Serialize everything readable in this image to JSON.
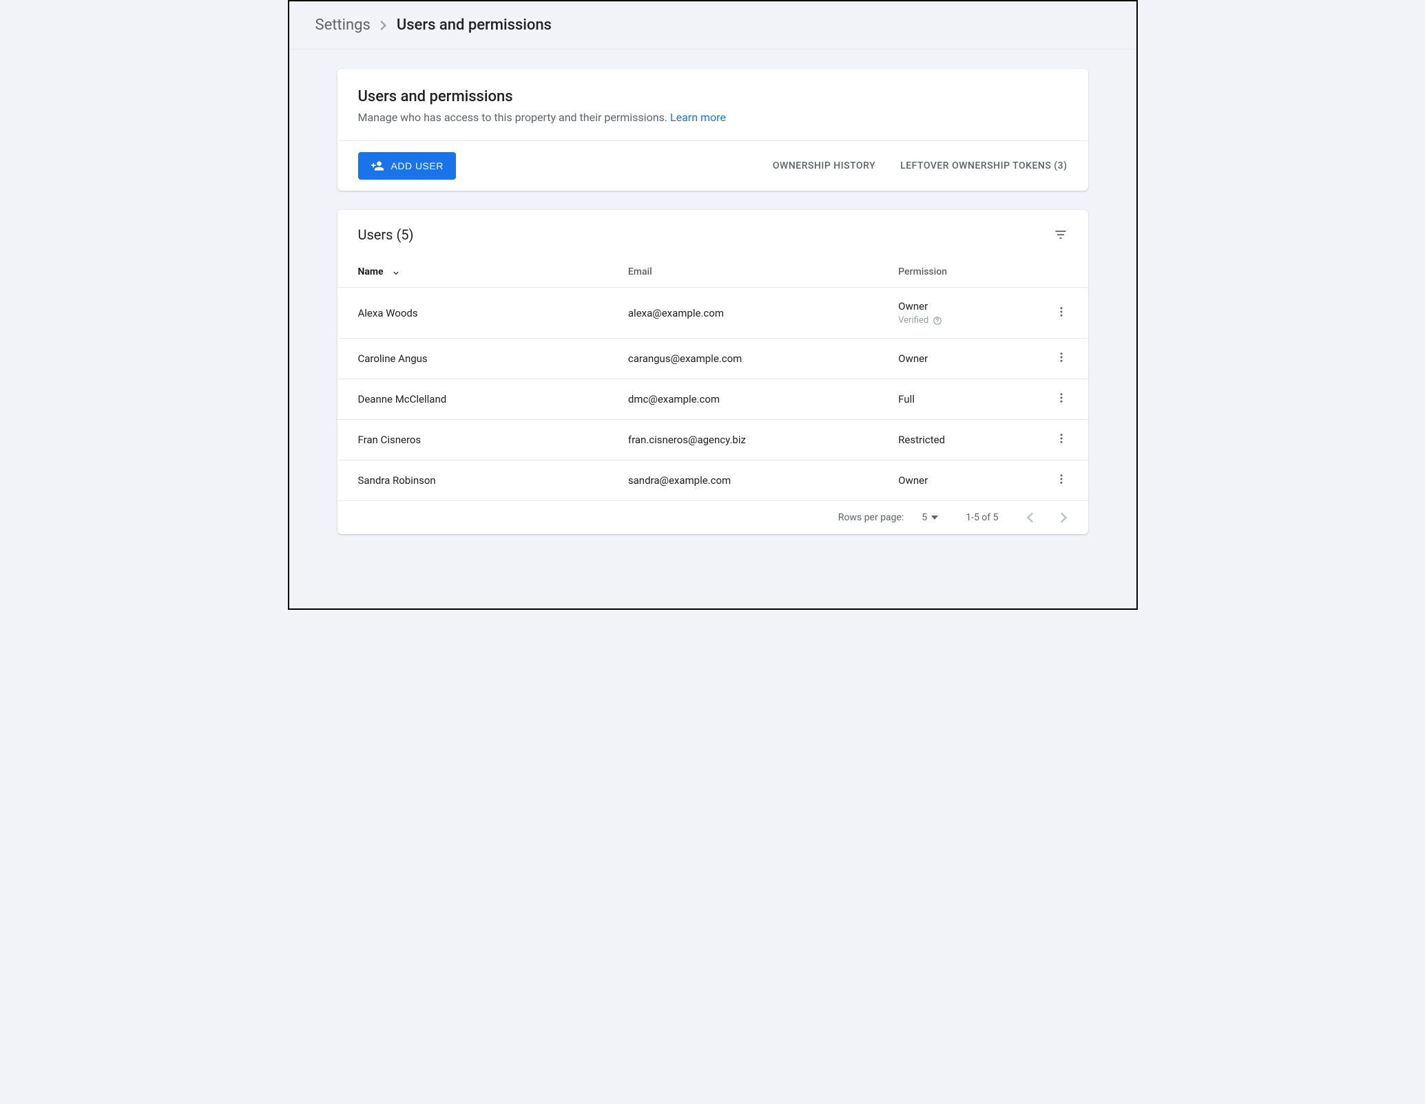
{
  "breadcrumb": {
    "root": "Settings",
    "leaf": "Users and permissions"
  },
  "intro": {
    "title": "Users and permissions",
    "subtitle": "Manage who has access to this property and their permissions.",
    "learn_more": "Learn more"
  },
  "actions": {
    "add_user": "ADD USER",
    "ownership_history": "OWNERSHIP HISTORY",
    "leftover_tokens": "LEFTOVER OWNERSHIP TOKENS (3)"
  },
  "users_section": {
    "title": "Users (5)",
    "columns": {
      "name": "Name",
      "email": "Email",
      "permission": "Permission"
    },
    "sorted_column": "name",
    "sort_direction": "desc",
    "verified_label": "Verified",
    "rows": [
      {
        "name": "Alexa Woods",
        "email": "alexa@example.com",
        "permission": "Owner",
        "verified": true
      },
      {
        "name": "Caroline Angus",
        "email": "carangus@example.com",
        "permission": "Owner",
        "verified": false
      },
      {
        "name": "Deanne McClelland",
        "email": "dmc@example.com",
        "permission": "Full",
        "verified": false
      },
      {
        "name": "Fran Cisneros",
        "email": "fran.cisneros@agency.biz",
        "permission": "Restricted",
        "verified": false
      },
      {
        "name": "Sandra Robinson",
        "email": "sandra@example.com",
        "permission": "Owner",
        "verified": false
      }
    ]
  },
  "pagination": {
    "rows_per_page_label": "Rows per page:",
    "rows_per_page_value": "5",
    "range": "1-5 of 5",
    "prev_enabled": false,
    "next_enabled": false
  }
}
